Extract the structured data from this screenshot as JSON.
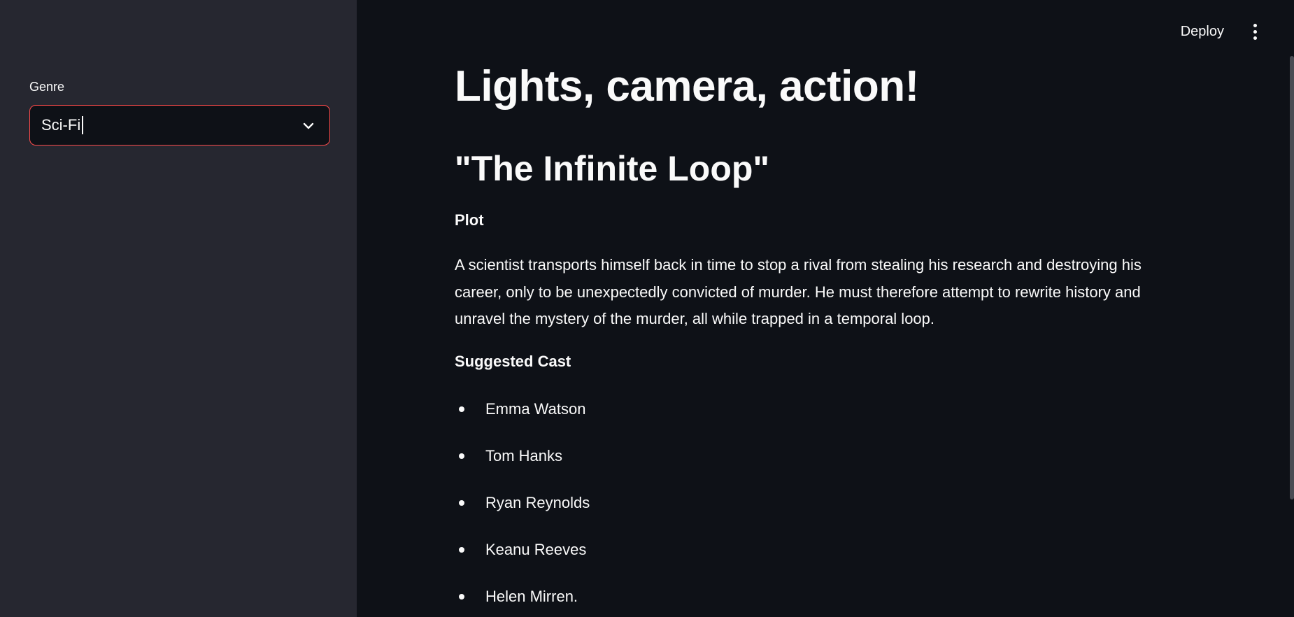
{
  "sidebar": {
    "genre_label": "Genre",
    "genre_value": "Sci-Fi"
  },
  "header": {
    "deploy_label": "Deploy",
    "menu_icon": "vertical-ellipsis-icon"
  },
  "main": {
    "title": "Lights, camera, action!",
    "movie_title": "\"The Infinite Loop\"",
    "plot_heading": "Plot",
    "plot_text": "A scientist transports himself back in time to stop a rival from stealing his research and destroying his career, only to be unexpectedly convicted of murder. He must therefore attempt to rewrite history and unravel the mystery of the murder, all while trapped in a temporal loop.",
    "cast_heading": "Suggested Cast",
    "cast": [
      "Emma Watson",
      "Tom Hanks",
      "Ryan Reynolds",
      "Keanu Reeves",
      "Helen Mirren."
    ]
  },
  "colors": {
    "background": "#0e1117",
    "sidebar": "#262730",
    "accent": "#ff4b4b",
    "text": "#fafafa"
  }
}
